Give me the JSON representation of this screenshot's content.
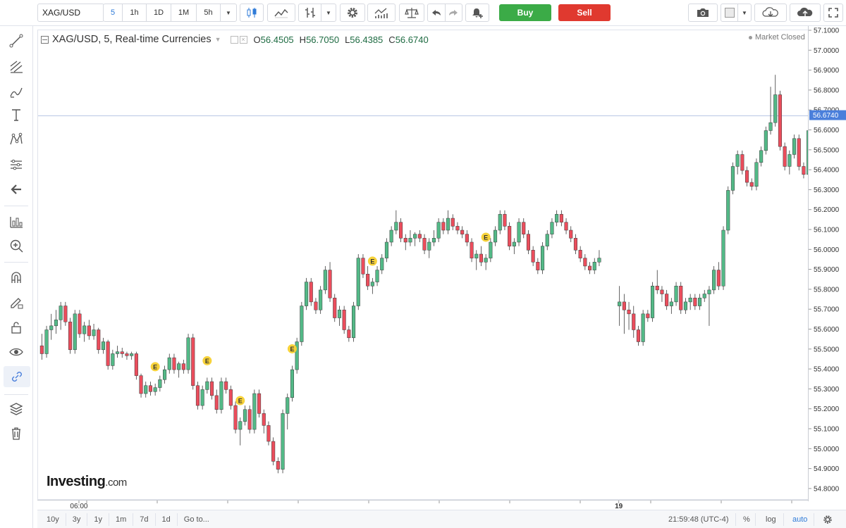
{
  "toolbar": {
    "symbol": "XAG/USD",
    "intervals": [
      "5",
      "1h",
      "1D",
      "1M",
      "5h"
    ],
    "active_interval": "5",
    "buy_label": "Buy",
    "sell_label": "Sell"
  },
  "legend": {
    "title": "XAG/USD, 5, Real-time Currencies",
    "open_label": "O",
    "open": "56.4505",
    "high_label": "H",
    "high": "56.7050",
    "low_label": "L",
    "low": "56.4385",
    "close_label": "C",
    "close": "56.6740",
    "market_status": "Market Closed"
  },
  "watermark": {
    "brand": "Investing",
    "suffix": ".com"
  },
  "price_axis": {
    "labels": [
      "57.1000",
      "57.0000",
      "56.9000",
      "56.8000",
      "56.7000",
      "56.6000",
      "56.5000",
      "56.4000",
      "56.3000",
      "56.2000",
      "56.1000",
      "56.0000",
      "55.9000",
      "55.8000",
      "55.7000",
      "55.6000",
      "55.5000",
      "55.4000",
      "55.3000",
      "55.2000",
      "55.1000",
      "55.0000",
      "54.9000",
      "54.8000"
    ],
    "last_price": "56.6740"
  },
  "time_axis": {
    "labels": [
      "06:00",
      "19"
    ]
  },
  "bottombar": {
    "ranges": [
      "10y",
      "3y",
      "1y",
      "1m",
      "7d",
      "1d"
    ],
    "goto": "Go to...",
    "clock": "21:59:48 (UTC-4)",
    "percent": "%",
    "log": "log",
    "auto": "auto"
  },
  "colors": {
    "up": "#53b987",
    "down": "#eb4d5c",
    "last_price_bg": "#4a7fdb",
    "event_badge": "#f7d23a",
    "buy": "#3bab47",
    "sell": "#e0392f"
  },
  "events": {
    "label": "E"
  },
  "chart_data": {
    "type": "candlestick",
    "symbol": "XAG/USD",
    "ylim": [
      54.75,
      57.12
    ],
    "last_price": 56.674,
    "candles": [
      [
        55.52,
        55.58,
        55.45,
        55.48
      ],
      [
        55.48,
        55.62,
        55.46,
        55.6
      ],
      [
        55.6,
        55.68,
        55.55,
        55.62
      ],
      [
        55.62,
        55.7,
        55.58,
        55.65
      ],
      [
        55.65,
        55.74,
        55.6,
        55.72
      ],
      [
        55.72,
        55.74,
        55.62,
        55.64
      ],
      [
        55.64,
        55.66,
        55.48,
        55.5
      ],
      [
        55.5,
        55.7,
        55.48,
        55.68
      ],
      [
        55.68,
        55.7,
        55.56,
        55.58
      ],
      [
        55.58,
        55.64,
        55.54,
        55.62
      ],
      [
        55.62,
        55.65,
        55.55,
        55.57
      ],
      [
        55.57,
        55.63,
        55.55,
        55.6
      ],
      [
        55.6,
        55.61,
        55.48,
        55.5
      ],
      [
        55.5,
        55.56,
        55.48,
        55.54
      ],
      [
        55.54,
        55.55,
        55.4,
        55.42
      ],
      [
        55.42,
        55.5,
        55.4,
        55.48
      ],
      [
        55.48,
        55.52,
        55.46,
        55.49
      ],
      [
        55.49,
        55.51,
        55.46,
        55.48
      ],
      [
        55.48,
        55.49,
        55.45,
        55.47
      ],
      [
        55.47,
        55.49,
        55.45,
        55.48
      ],
      [
        55.48,
        55.49,
        55.35,
        55.37
      ],
      [
        55.37,
        55.38,
        55.26,
        55.28
      ],
      [
        55.28,
        55.34,
        55.26,
        55.32
      ],
      [
        55.32,
        55.34,
        55.27,
        55.29
      ],
      [
        55.29,
        55.33,
        55.27,
        55.31
      ],
      [
        55.31,
        55.37,
        55.29,
        55.35
      ],
      [
        55.35,
        55.42,
        55.33,
        55.4
      ],
      [
        55.4,
        55.48,
        55.38,
        55.46
      ],
      [
        55.46,
        55.48,
        55.38,
        55.4
      ],
      [
        55.4,
        55.44,
        55.36,
        55.43
      ],
      [
        55.43,
        55.45,
        55.38,
        55.4
      ],
      [
        55.4,
        55.58,
        55.38,
        55.56
      ],
      [
        55.56,
        55.58,
        55.3,
        55.32
      ],
      [
        55.32,
        55.34,
        55.2,
        55.22
      ],
      [
        55.22,
        55.32,
        55.2,
        55.3
      ],
      [
        55.3,
        55.36,
        55.28,
        55.34
      ],
      [
        55.34,
        55.36,
        55.25,
        55.27
      ],
      [
        55.27,
        55.3,
        55.18,
        55.2
      ],
      [
        55.2,
        55.36,
        55.18,
        55.34
      ],
      [
        55.34,
        55.36,
        55.28,
        55.3
      ],
      [
        55.3,
        55.32,
        55.2,
        55.22
      ],
      [
        55.22,
        55.24,
        55.08,
        55.1
      ],
      [
        55.1,
        55.16,
        55.02,
        55.14
      ],
      [
        55.14,
        55.22,
        55.12,
        55.2
      ],
      [
        55.2,
        55.22,
        55.08,
        55.1
      ],
      [
        55.1,
        55.3,
        55.08,
        55.28
      ],
      [
        55.28,
        55.3,
        55.16,
        55.18
      ],
      [
        55.18,
        55.2,
        55.08,
        55.12
      ],
      [
        55.12,
        55.14,
        55.02,
        55.04
      ],
      [
        55.04,
        55.06,
        54.92,
        54.94
      ],
      [
        54.94,
        54.96,
        54.88,
        54.9
      ],
      [
        54.9,
        55.2,
        54.88,
        55.18
      ],
      [
        55.18,
        55.28,
        55.1,
        55.26
      ],
      [
        55.26,
        55.42,
        55.24,
        55.4
      ],
      [
        55.4,
        55.56,
        55.38,
        55.54
      ],
      [
        55.54,
        55.74,
        55.52,
        55.72
      ],
      [
        55.72,
        55.86,
        55.7,
        55.84
      ],
      [
        55.84,
        55.86,
        55.72,
        55.74
      ],
      [
        55.74,
        55.76,
        55.68,
        55.7
      ],
      [
        55.7,
        55.82,
        55.68,
        55.8
      ],
      [
        55.8,
        55.92,
        55.78,
        55.9
      ],
      [
        55.9,
        55.94,
        55.74,
        55.76
      ],
      [
        55.76,
        55.78,
        55.64,
        55.66
      ],
      [
        55.66,
        55.72,
        55.62,
        55.7
      ],
      [
        55.7,
        55.72,
        55.58,
        55.6
      ],
      [
        55.6,
        55.62,
        55.54,
        55.56
      ],
      [
        55.56,
        55.74,
        55.54,
        55.72
      ],
      [
        55.72,
        55.98,
        55.7,
        55.96
      ],
      [
        55.96,
        55.98,
        55.86,
        55.88
      ],
      [
        55.88,
        55.92,
        55.8,
        55.82
      ],
      [
        55.82,
        55.86,
        55.78,
        55.84
      ],
      [
        55.84,
        55.92,
        55.82,
        55.9
      ],
      [
        55.9,
        55.98,
        55.88,
        55.96
      ],
      [
        55.96,
        56.06,
        55.94,
        56.04
      ],
      [
        56.04,
        56.12,
        56.02,
        56.1
      ],
      [
        56.1,
        56.2,
        56.08,
        56.14
      ],
      [
        56.14,
        56.16,
        56.04,
        56.06
      ],
      [
        56.06,
        56.08,
        56.0,
        56.04
      ],
      [
        56.04,
        56.1,
        56.02,
        56.06
      ],
      [
        56.06,
        56.09,
        56.02,
        56.08
      ],
      [
        56.08,
        56.1,
        56.04,
        56.06
      ],
      [
        56.06,
        56.08,
        55.98,
        56.0
      ],
      [
        56.0,
        56.06,
        55.96,
        56.04
      ],
      [
        56.04,
        56.1,
        56.02,
        56.06
      ],
      [
        56.06,
        56.16,
        56.04,
        56.14
      ],
      [
        56.14,
        56.16,
        56.08,
        56.1
      ],
      [
        56.1,
        56.2,
        56.08,
        56.16
      ],
      [
        56.16,
        56.18,
        56.1,
        56.12
      ],
      [
        56.12,
        56.14,
        56.08,
        56.1
      ],
      [
        56.1,
        56.12,
        56.06,
        56.08
      ],
      [
        56.08,
        56.1,
        56.02,
        56.04
      ],
      [
        56.04,
        56.06,
        55.94,
        55.96
      ],
      [
        55.96,
        56.0,
        55.9,
        55.98
      ],
      [
        55.98,
        56.02,
        55.92,
        55.94
      ],
      [
        55.94,
        55.98,
        55.9,
        55.96
      ],
      [
        55.96,
        56.06,
        55.94,
        56.04
      ],
      [
        56.04,
        56.12,
        56.02,
        56.1
      ],
      [
        56.1,
        56.2,
        56.08,
        56.18
      ],
      [
        56.18,
        56.2,
        56.1,
        56.12
      ],
      [
        56.12,
        56.14,
        56.0,
        56.02
      ],
      [
        56.02,
        56.06,
        55.98,
        56.04
      ],
      [
        56.04,
        56.16,
        56.02,
        56.14
      ],
      [
        56.14,
        56.16,
        56.06,
        56.08
      ],
      [
        56.08,
        56.1,
        55.98,
        56.0
      ],
      [
        56.0,
        56.02,
        55.92,
        55.94
      ],
      [
        55.94,
        55.96,
        55.88,
        55.9
      ],
      [
        55.9,
        56.04,
        55.88,
        56.02
      ],
      [
        56.02,
        56.1,
        56.0,
        56.08
      ],
      [
        56.08,
        56.16,
        56.06,
        56.14
      ],
      [
        56.14,
        56.2,
        56.12,
        56.18
      ],
      [
        56.18,
        56.2,
        56.12,
        56.14
      ],
      [
        56.14,
        56.16,
        56.08,
        56.1
      ],
      [
        56.1,
        56.12,
        56.04,
        56.06
      ],
      [
        56.06,
        56.08,
        55.98,
        56.0
      ],
      [
        56.0,
        56.02,
        55.94,
        55.96
      ],
      [
        55.96,
        55.98,
        55.9,
        55.92
      ],
      [
        55.92,
        55.94,
        55.88,
        55.9
      ],
      [
        55.9,
        55.96,
        55.88,
        55.94
      ],
      [
        55.94,
        56.0,
        55.92,
        55.96
      ],
      [
        55.72,
        55.82,
        55.62,
        55.74
      ],
      [
        55.74,
        55.78,
        55.58,
        55.7
      ],
      [
        55.7,
        55.74,
        55.6,
        55.68
      ],
      [
        55.68,
        55.72,
        55.56,
        55.6
      ],
      [
        55.6,
        55.62,
        55.52,
        55.54
      ],
      [
        55.54,
        55.7,
        55.52,
        55.68
      ],
      [
        55.68,
        55.7,
        55.64,
        55.66
      ],
      [
        55.66,
        55.84,
        55.64,
        55.82
      ],
      [
        55.82,
        55.9,
        55.78,
        55.8
      ],
      [
        55.8,
        55.82,
        55.74,
        55.78
      ],
      [
        55.78,
        55.8,
        55.7,
        55.72
      ],
      [
        55.72,
        55.76,
        55.68,
        55.74
      ],
      [
        55.74,
        55.84,
        55.72,
        55.82
      ],
      [
        55.82,
        55.84,
        55.68,
        55.7
      ],
      [
        55.7,
        55.76,
        55.68,
        55.74
      ],
      [
        55.74,
        55.78,
        55.7,
        55.76
      ],
      [
        55.76,
        55.78,
        55.7,
        55.72
      ],
      [
        55.72,
        55.78,
        55.7,
        55.76
      ],
      [
        55.76,
        55.8,
        55.74,
        55.78
      ],
      [
        55.78,
        55.82,
        55.62,
        55.8
      ],
      [
        55.8,
        55.92,
        55.78,
        55.9
      ],
      [
        55.9,
        55.94,
        55.8,
        55.82
      ],
      [
        55.82,
        56.12,
        55.8,
        56.1
      ],
      [
        56.1,
        56.32,
        56.08,
        56.3
      ],
      [
        56.3,
        56.44,
        56.28,
        56.42
      ],
      [
        56.42,
        56.5,
        56.38,
        56.48
      ],
      [
        56.48,
        56.5,
        56.38,
        56.4
      ],
      [
        56.4,
        56.42,
        56.32,
        56.34
      ],
      [
        56.34,
        56.36,
        56.3,
        56.32
      ],
      [
        56.32,
        56.46,
        56.3,
        56.44
      ],
      [
        56.44,
        56.52,
        56.42,
        56.5
      ],
      [
        56.5,
        56.62,
        56.48,
        56.6
      ],
      [
        56.6,
        56.82,
        56.58,
        56.64
      ],
      [
        56.64,
        56.88,
        56.62,
        56.78
      ],
      [
        56.78,
        56.8,
        56.5,
        56.52
      ],
      [
        56.52,
        56.54,
        56.4,
        56.42
      ],
      [
        56.42,
        56.5,
        56.38,
        56.48
      ],
      [
        56.48,
        56.58,
        56.46,
        56.56
      ],
      [
        56.56,
        56.58,
        56.4,
        56.42
      ],
      [
        56.42,
        56.44,
        56.36,
        56.38
      ],
      [
        56.38,
        56.62,
        56.36,
        56.6
      ],
      [
        56.6,
        56.62,
        56.44,
        56.46
      ],
      [
        56.4505,
        56.705,
        56.4385,
        56.674
      ]
    ],
    "gap_after_index": 118,
    "events": [
      [
        24,
        "E"
      ],
      [
        35,
        "E"
      ],
      [
        42,
        "E"
      ],
      [
        53,
        "E"
      ],
      [
        70,
        "E"
      ],
      [
        94,
        "E"
      ]
    ],
    "x_tick_labels": [
      [
        8,
        "06:00"
      ],
      [
        119,
        "19"
      ]
    ]
  }
}
